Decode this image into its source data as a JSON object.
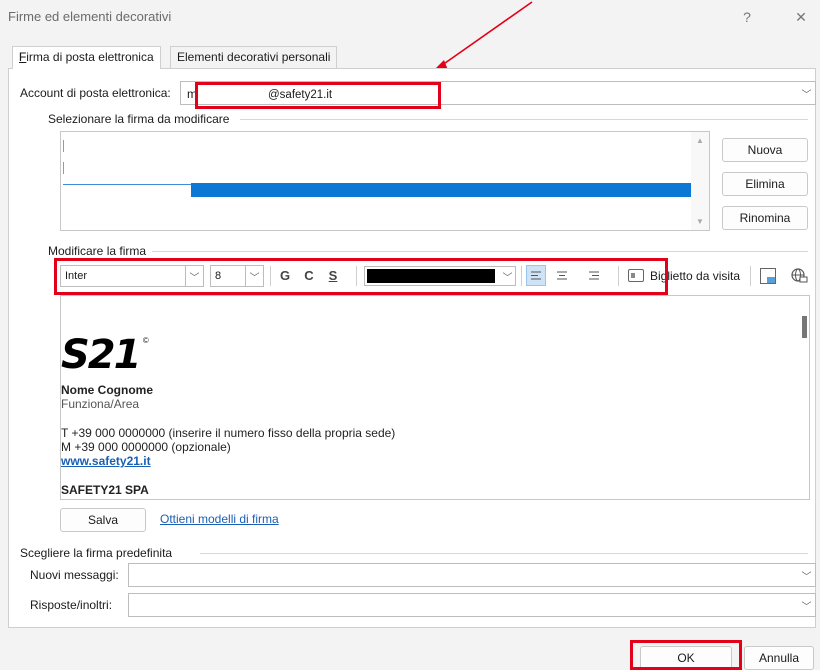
{
  "window": {
    "title": "Firme ed elementi decorativi",
    "help_label": "?",
    "close_label": "✕"
  },
  "tabs": [
    {
      "label": "Firma di posta elettronica",
      "active": true
    },
    {
      "label": "Elementi decorativi personali",
      "active": false
    }
  ],
  "account": {
    "label": "Account di posta elettronica:",
    "prefix": "m",
    "value": "@safety21.it"
  },
  "signature_select": {
    "group_label": "Selezionare la firma da modificare",
    "new_button": "Nuova",
    "delete_button": "Elimina",
    "rename_button": "Rinomina"
  },
  "edit": {
    "group_label": "Modificare la firma",
    "font": "Inter",
    "size": "8",
    "bold": "G",
    "italic": "C",
    "underline": "S",
    "business_card": "Biglietto da visita"
  },
  "signature": {
    "logo_text": "S21",
    "logo_mark": "©",
    "name": "Nome Cognome",
    "role": "Funziona/Area",
    "phone": "T +39 000 0000000 (inserire il numero fisso della propria sede)",
    "mobile": "M +39 000 0000000 (opzionale)",
    "website": "www.safety21.it",
    "company": "SAFETY21 SPA"
  },
  "save_button": "Salva",
  "templates_link": "Ottieni modelli di firma",
  "defaults": {
    "group_label": "Scegliere la firma predefinita",
    "new_messages_label": "Nuovi messaggi:",
    "replies_label": "Risposte/inoltri:",
    "new_messages_value": "",
    "replies_value": ""
  },
  "footer": {
    "ok": "OK",
    "cancel": "Annulla"
  },
  "colors": {
    "highlight": "#e3001b",
    "selection": "#0a78d4",
    "link": "#1a5fb4"
  }
}
